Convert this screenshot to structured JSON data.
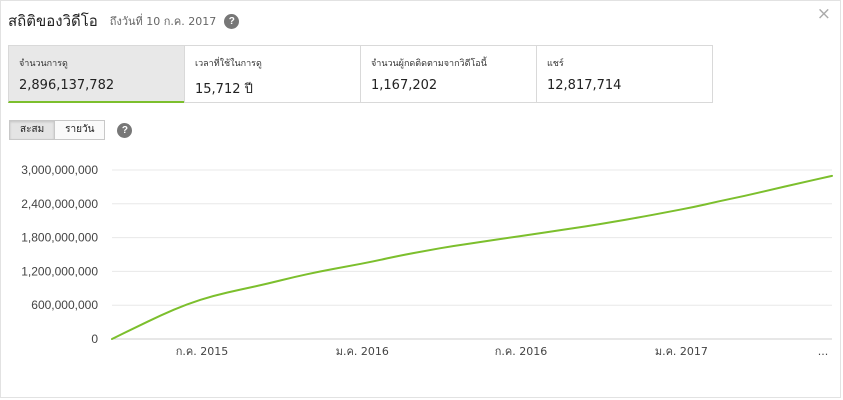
{
  "header": {
    "title": "สถิติของวิดีโอ",
    "subtitle": "ถึงวันที่ 10 ก.ค. 2017",
    "help_icon": "?",
    "close_icon": "×"
  },
  "stats": [
    {
      "label": "จำนวนการดู",
      "value": "2,896,137,782",
      "active": true
    },
    {
      "label": "เวลาที่ใช้ในการดู",
      "value": "15,712 ปี",
      "active": false
    },
    {
      "label": "จำนวนผู้กดติดตามจากวิดีโอนี้",
      "value": "1,167,202",
      "active": false
    },
    {
      "label": "แชร์",
      "value": "12,817,714",
      "active": false
    }
  ],
  "toggle": {
    "cumulative": "สะสม",
    "daily": "รายวัน",
    "help_icon": "?"
  },
  "colors": {
    "accent": "#7cbf2d",
    "line": "#7cbf2d",
    "grid": "#e8e8e8"
  },
  "chart_data": {
    "type": "line",
    "y_ticks": [
      "3,000,000,000",
      "2,400,000,000",
      "1,800,000,000",
      "1,200,000,000",
      "600,000,000",
      "0"
    ],
    "x_ticks": [
      "ก.ค. 2015",
      "ม.ค. 2016",
      "ก.ค. 2016",
      "ม.ค. 2017",
      "..."
    ],
    "ylim": [
      0,
      3000000000
    ],
    "grid": true,
    "series": [
      {
        "x": [
          "2015-04-06",
          "2015-05-01",
          "2015-06-01",
          "2015-07-01",
          "2015-08-01",
          "2015-09-01",
          "2015-10-01",
          "2015-11-01",
          "2015-12-01",
          "2016-01-01",
          "2016-02-01",
          "2016-03-01",
          "2016-04-01",
          "2016-05-01",
          "2016-06-01",
          "2016-07-01",
          "2016-08-01",
          "2016-09-01",
          "2016-10-01",
          "2016-11-01",
          "2016-12-01",
          "2017-01-01",
          "2017-02-01",
          "2017-03-01",
          "2017-04-01",
          "2017-05-01",
          "2017-06-01",
          "2017-07-10"
        ],
        "values": [
          0,
          190000000,
          420000000,
          620000000,
          770000000,
          880000000,
          980000000,
          1100000000,
          1200000000,
          1290000000,
          1380000000,
          1480000000,
          1570000000,
          1650000000,
          1720000000,
          1790000000,
          1860000000,
          1930000000,
          2000000000,
          2080000000,
          2160000000,
          2250000000,
          2340000000,
          2440000000,
          2540000000,
          2650000000,
          2760000000,
          2896137782
        ]
      }
    ]
  }
}
